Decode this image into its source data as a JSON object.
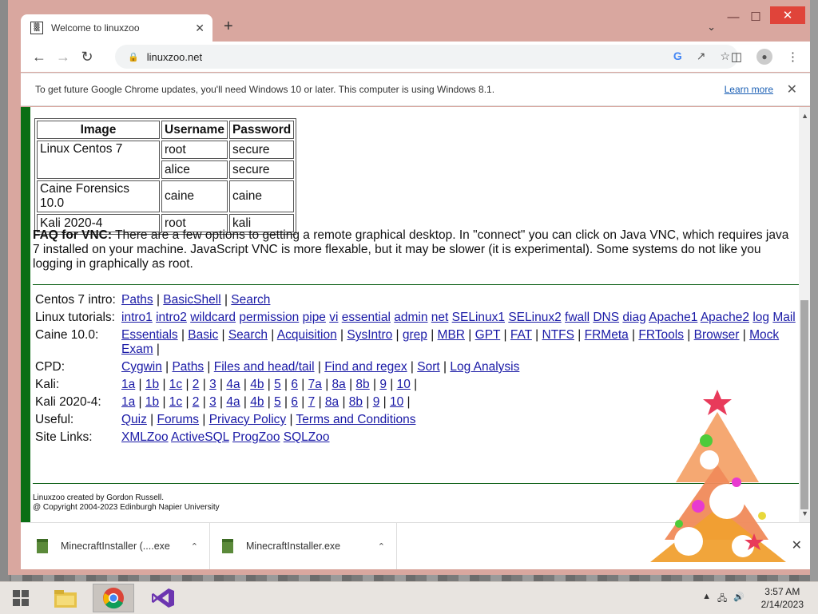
{
  "browser": {
    "tab_title": "Welcome to linuxzoo",
    "url": "linuxzoo.net",
    "new_tab": "+",
    "infobar_text": "To get future Google Chrome updates, you'll need Windows 10 or later. This computer is using Windows 8.1.",
    "infobar_link": "Learn more"
  },
  "credentials_table": {
    "headers": [
      "Image",
      "Username",
      "Password"
    ],
    "rows": [
      {
        "image": "Linux Centos 7",
        "username": "root",
        "password": "secure"
      },
      {
        "image": "",
        "username": "alice",
        "password": "secure"
      },
      {
        "image": "Caine Forensics 10.0",
        "username": "caine",
        "password": "caine"
      },
      {
        "image": "Kali 2020-4",
        "username": "root",
        "password": "kali"
      }
    ]
  },
  "faq": {
    "heading": "FAQ for VNC:",
    "text": " There are a few options to getting a remote graphical desktop. In \"connect\" you can click on Java VNC, which requires java 7 installed on your machine. JavaScript VNC is more flexable, but it may be slower (it is experimental). Some systems do not like you logging in graphically as root."
  },
  "link_rows": [
    {
      "label": "Centos 7 intro:",
      "links": [
        "Paths",
        "BasicShell",
        "Search"
      ],
      "sep": " | ",
      "trail": ""
    },
    {
      "label": "Linux tutorials:",
      "links": [
        "intro1",
        "intro2",
        "wildcard",
        "permission",
        "pipe",
        "vi",
        "essential",
        "admin",
        "net",
        "SELinux1",
        "SELinux2",
        "fwall",
        "DNS",
        "diag",
        "Apache1",
        "Apache2",
        "log",
        "Mail"
      ],
      "sep": " ",
      "trail": ""
    },
    {
      "label": "Caine 10.0:",
      "links": [
        "Essentials",
        "Basic",
        "Search",
        "Acquisition",
        "SysIntro",
        "grep",
        "MBR",
        "GPT",
        "FAT",
        "NTFS",
        "FRMeta",
        "FRTools",
        "Browser",
        "Mock Exam"
      ],
      "sep": " | ",
      "trail": " |"
    },
    {
      "label": "CPD:",
      "links": [
        "Cygwin",
        "Paths",
        "Files and head/tail",
        "Find and regex",
        "Sort",
        "Log Analysis"
      ],
      "sep": " | ",
      "trail": ""
    },
    {
      "label": "Kali:",
      "links": [
        "1a",
        "1b",
        "1c",
        "2",
        "3",
        "4a",
        "4b",
        "5",
        "6",
        "7a",
        "8a",
        "8b",
        "9",
        "10"
      ],
      "sep": " | ",
      "trail": " |"
    },
    {
      "label": "Kali 2020-4:",
      "links": [
        "1a",
        "1b",
        "1c",
        "2",
        "3",
        "4a",
        "4b",
        "5",
        "6",
        "7",
        "8a",
        "8b",
        "9",
        "10"
      ],
      "sep": " | ",
      "trail": " |"
    },
    {
      "label": "Useful:",
      "links": [
        "Quiz",
        "Forums",
        "Privacy Policy",
        "Terms and Conditions"
      ],
      "sep": " | ",
      "trail": ""
    },
    {
      "label": "Site Links:",
      "links": [
        "XMLZoo",
        "ActiveSQL",
        "ProgZoo",
        "SQLZoo"
      ],
      "sep": " ",
      "trail": ""
    }
  ],
  "footer": {
    "line1": "Linuxzoo created by Gordon Russell.",
    "line2": "@ Copyright 2004-2023 Edinburgh Napier University"
  },
  "downloads": [
    {
      "name": "MinecraftInstaller (....exe"
    },
    {
      "name": "MinecraftInstaller.exe"
    }
  ],
  "taskbar": {
    "time": "3:57 AM",
    "date": "2/14/2023"
  },
  "colors": {
    "accent_green": "#0a6e14",
    "link": "#1a1aa6",
    "window_frame": "#d9a79f"
  }
}
